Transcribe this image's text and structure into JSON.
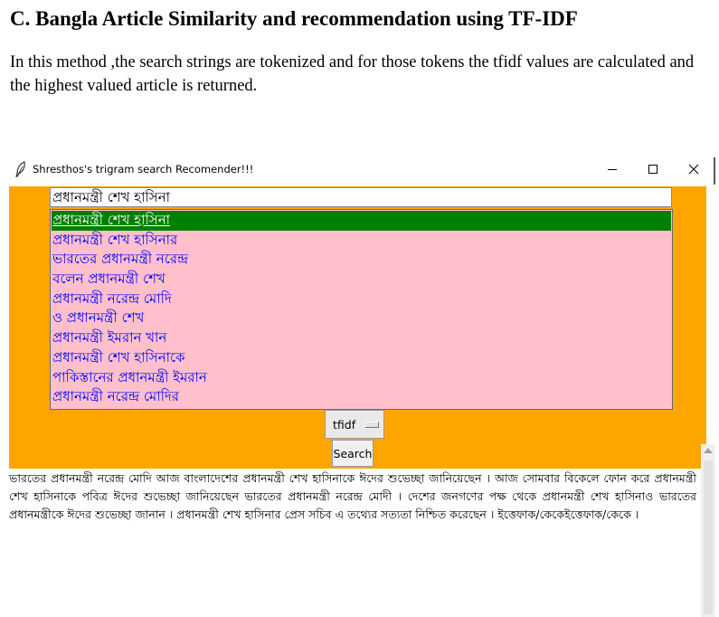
{
  "document": {
    "heading": "C. Bangla Article Similarity and recommendation using TF-IDF",
    "paragraph": "In this method ,the search strings are tokenized and for those tokens the tfidf values are calculated and the highest valued article is returned."
  },
  "window": {
    "title": "Shresthos's trigram search Recomender!!!",
    "icon": "feather-icon",
    "controls": [
      "minimize-icon",
      "maximize-icon",
      "close-icon"
    ]
  },
  "app": {
    "search_value": "প্রধানমন্ত্রী শেখ হাসিনা",
    "suggestions": [
      "প্রধানমন্ত্রী শেখ হাসিনা",
      "প্রধানমন্ত্রী শেখ হাসিনার",
      "ভারতের প্রধানমন্ত্রী নরেন্দ্র",
      "বলেন প্রধানমন্ত্রী শেখ",
      "প্রধানমন্ত্রী নরেন্দ্র মোদি",
      "ও প্রধানমন্ত্রী শেখ",
      "প্রধানমন্ত্রী ইমরান খান",
      "প্রধানমন্ত্রী শেখ হাসিনাকে",
      "পাকিস্তানের প্রধানমন্ত্রী ইমরান",
      "প্রধানমন্ত্রী নরেন্দ্র মোদির"
    ],
    "selected_index": 0,
    "method_value": "tfidf",
    "search_label": "Search",
    "result": "ভারতের প্রধানমন্ত্রী নরেন্দ্র মোদি আজ বাংলাদেশের প্রধানমন্ত্রী শেখ হাসিনাকে ঈদের শুভেচ্ছা জানিয়েছেন । আজ সোমবার বিকেলে ফোন করে প্রধানমন্ত্রী শেখ হাসিনাকে পবিত্র ঈদের শুভেচ্ছা জানিয়েছেন ভারতের প্রধানমন্ত্রী নরেন্দ্র মোদী । দেশের জনগণের পক্ষ থেকে প্রধানমন্ত্রী শেখ হাসিনাও ভারতের প্রধানমন্ত্রীকে ঈদের শুভেচ্ছা জানান । প্রধানমন্ত্রী শেখ হাসিনার প্রেস সচিব এ তথ্যের সত্যতা নিশ্চিত করেছেন । ইত্তেফাক/কেকেইত্তেফাক/কেকে ।"
  },
  "colors": {
    "panel_background": "#ffa500",
    "list_background": "#ffc0cb",
    "selected_background": "#008000",
    "suggestion_text": "#0000ff"
  }
}
